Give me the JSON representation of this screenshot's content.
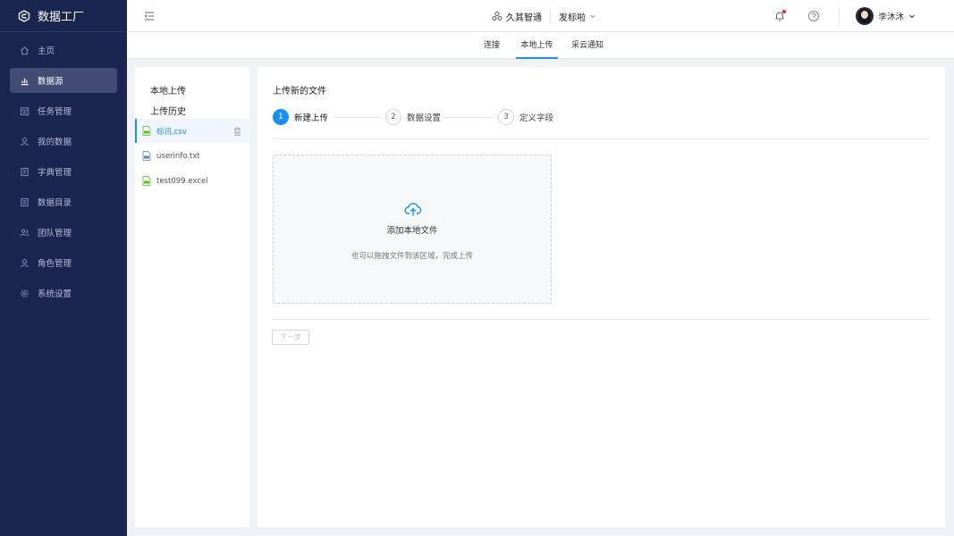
{
  "app": {
    "name": "数据工厂"
  },
  "sidebar": {
    "items": [
      {
        "label": "主页",
        "icon": "home-icon"
      },
      {
        "label": "数据源",
        "icon": "chart-icon"
      },
      {
        "label": "任务管理",
        "icon": "calendar-icon"
      },
      {
        "label": "我的数据",
        "icon": "user-icon"
      },
      {
        "label": "字典管理",
        "icon": "dictionary-icon"
      },
      {
        "label": "数据目录",
        "icon": "catalog-icon"
      },
      {
        "label": "团队管理",
        "icon": "team-icon"
      },
      {
        "label": "角色管理",
        "icon": "role-icon"
      },
      {
        "label": "系统设置",
        "icon": "settings-icon"
      }
    ],
    "active_index": 1
  },
  "header": {
    "org_name": "久其智通",
    "project_name": "发标啦",
    "user_name": "李沐沐"
  },
  "tabs": [
    {
      "label": "连接"
    },
    {
      "label": "本地上传"
    },
    {
      "label": "采云通知"
    }
  ],
  "left_panel": {
    "local_upload_label": "本地上传",
    "history_label": "上传历史",
    "files": [
      {
        "name": "标讯.csv"
      },
      {
        "name": "userinfo.txt"
      },
      {
        "name": "test099.excel"
      }
    ]
  },
  "main": {
    "title": "上传新的文件",
    "steps": [
      {
        "num": "1",
        "label": "新建上传"
      },
      {
        "num": "2",
        "label": "数据设置"
      },
      {
        "num": "3",
        "label": "定义字段"
      }
    ],
    "dropzone": {
      "title": "添加本地文件",
      "hint": "也可以拖拽文件到该区域，完成上传"
    },
    "next_button": "下一步"
  },
  "colors": {
    "sidebar_bg": "#1a2550",
    "accent": "#1890ff",
    "active_item": "#414b73"
  }
}
